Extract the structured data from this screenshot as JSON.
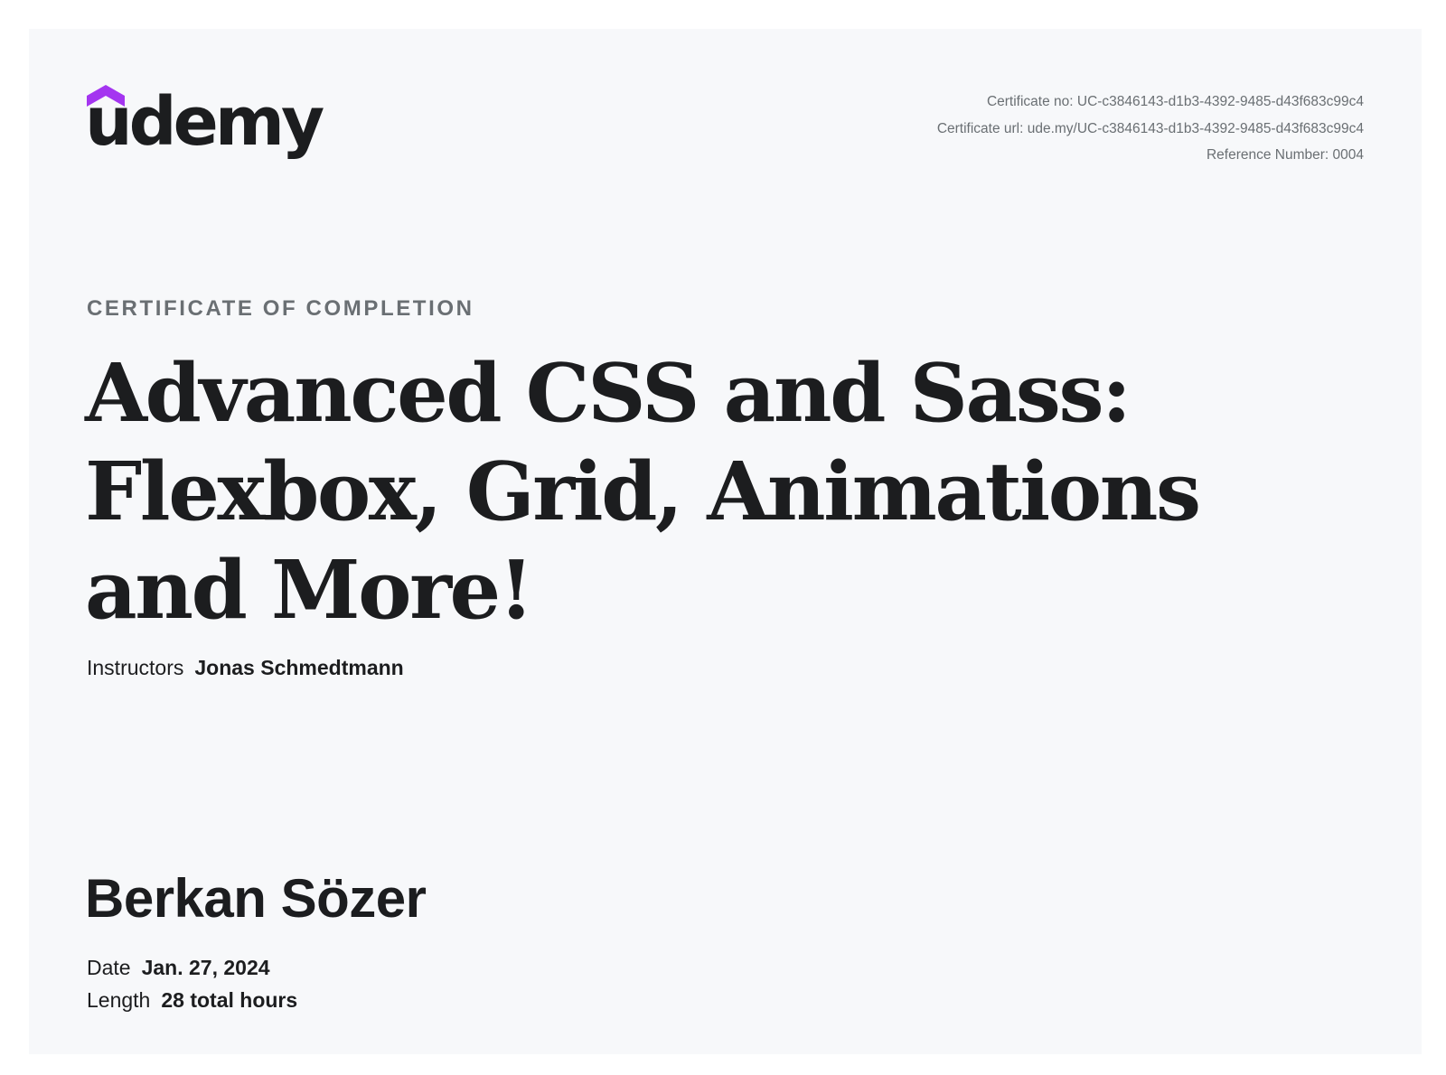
{
  "brand": {
    "name": "udemy",
    "accent_color": "#a435f0",
    "icon": "udemy-hat-icon"
  },
  "certificate": {
    "number_line": "Certificate no: UC-c3846143-d1b3-4392-9485-d43f683c99c4",
    "url_line": "Certificate url: ude.my/UC-c3846143-d1b3-4392-9485-d43f683c99c4",
    "reference_line": "Reference Number: 0004",
    "kicker": "CERTIFICATE OF COMPLETION",
    "course_title": "Advanced CSS and Sass: Flexbox, Grid, Animations and More!",
    "instructors_label": "Instructors",
    "instructors_value": "Jonas Schmedtmann",
    "recipient": "Berkan Sözer",
    "date_label": "Date",
    "date_value": "Jan. 27, 2024",
    "length_label": "Length",
    "length_value": "28 total hours"
  }
}
